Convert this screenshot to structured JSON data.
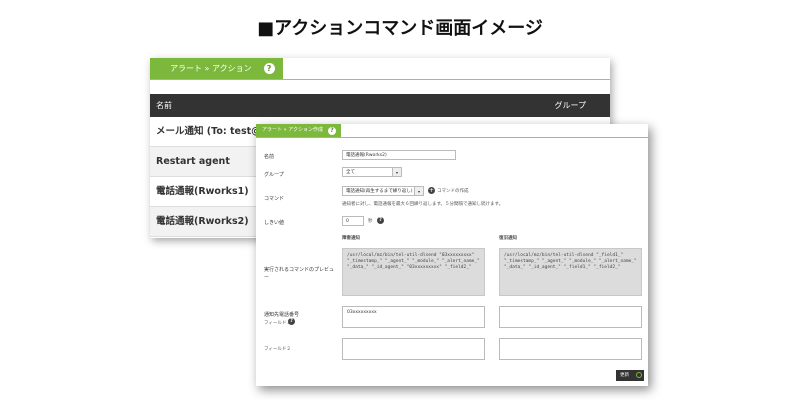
{
  "page_title": "■アクションコマンド画面イメージ",
  "back": {
    "tab_label": "アラート » アクション",
    "help": "?",
    "col_name": "名前",
    "col_group": "グループ",
    "rows": [
      "メール通知 (To: test@ex",
      "Restart agent",
      "電話通報(Rworks1)",
      "電話通報(Rworks2)"
    ]
  },
  "front": {
    "tab_label": "アラート » アクション作成",
    "help": "?",
    "name_label": "名前",
    "name_value": "電話通報(Rworks2)",
    "group_label": "グループ",
    "group_value": "全て",
    "command_label": "コマンド",
    "command_value": "電話通知(再生するまで繰り返し)",
    "command_new": "コマンドの作成",
    "command_note": "通知者に対し、電話通報を最大６回繰り返します。５分間隔で通知し続けます。",
    "threshold_label": "しきい値",
    "threshold_value": "0",
    "threshold_unit": "秒",
    "col_fail": "障害通知",
    "col_recover": "復旧通知",
    "preview_label": "実行されるコマンドのプレビュー",
    "preview_fail": "/usr/local/mz/bin/tel-util-dlsend \"03xxxxxxxxx\" \"_timestamp_\" \"_agent_\" \"_module_\" \"_alert_name_\" \"_data_\" \"_id_agent_\" \"03xxxxxxxxx\" \"_field2_\"",
    "preview_recover": "/usr/local/mz/bin/tel-util-dlsend \"_field1_\" \"_timestamp_\" \"_agent_\" \"_module_\" \"_alert_name_\" \"_data_\" \"_id_agent_\" \"_field1_\" \"_field2_\"",
    "phone_label": "通知先電話番号",
    "phone_sub": "フィールド１",
    "phone_value": "03xxxxxxxxx",
    "field2_label": "フィールド２",
    "save_label": "更新"
  }
}
